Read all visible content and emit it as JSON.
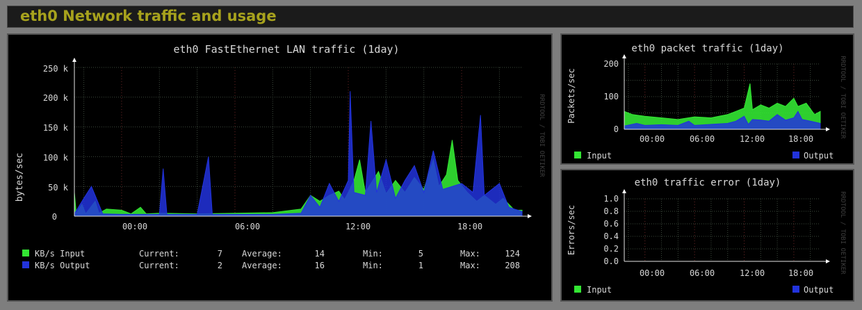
{
  "header": {
    "title": "eth0 Network traffic and usage"
  },
  "colors": {
    "input": "#33e633",
    "output": "#2233dd",
    "grid": "#3d4a3d",
    "accent": "#a7a21d"
  },
  "main_chart": {
    "title": "eth0 FastEthernet LAN traffic   (1day)",
    "ylabel": "bytes/sec",
    "watermark": "RRDTOOL / TOBI OETIKER",
    "y_ticks": [
      "250 k",
      "200 k",
      "150 k",
      "100 k",
      "50 k",
      "0"
    ],
    "x_ticks": [
      "00:00",
      "06:00",
      "12:00",
      "18:00"
    ],
    "legend": [
      {
        "name": "KB/s Input",
        "current_label": "Current:",
        "current": "7",
        "average_label": "Average:",
        "average": "14",
        "min_label": "Min:",
        "min": "5",
        "max_label": "Max:",
        "max": "124"
      },
      {
        "name": "KB/s Output",
        "current_label": "Current:",
        "current": "2",
        "average_label": "Average:",
        "average": "16",
        "min_label": "Min:",
        "min": "1",
        "max_label": "Max:",
        "max": "208"
      }
    ]
  },
  "packet_chart": {
    "title": "eth0 packet traffic   (1day)",
    "ylabel": "Packets/sec",
    "watermark": "RRDTOOL / TOBI OETIKER",
    "y_ticks": [
      "200",
      "100",
      "0"
    ],
    "x_ticks": [
      "00:00",
      "06:00",
      "12:00",
      "18:00"
    ],
    "legend_input": "Input",
    "legend_output": "Output"
  },
  "error_chart": {
    "title": "eth0 traffic error   (1day)",
    "ylabel": "Errors/sec",
    "watermark": "RRDTOOL / TOBI OETIKER",
    "y_ticks": [
      "1.0",
      "0.8",
      "0.6",
      "0.4",
      "0.2",
      "0.0"
    ],
    "x_ticks": [
      "00:00",
      "06:00",
      "12:00",
      "18:00"
    ],
    "legend_input": "Input",
    "legend_output": "Output"
  },
  "chart_data": [
    {
      "type": "area",
      "title": "eth0 FastEthernet LAN traffic   (1day)",
      "ylabel": "bytes/sec",
      "x_unit": "hours",
      "xlim": [
        -2.5,
        21.2
      ],
      "ylim": [
        0,
        250000
      ],
      "grid": true,
      "legend_placement": "bottom-left",
      "series": [
        {
          "name": "KB/s Input",
          "color": "#33e633",
          "points": [
            [
              -2.5,
              40000
            ],
            [
              -2.4,
              5000
            ],
            [
              -2.1,
              20000
            ],
            [
              -1.9,
              4000
            ],
            [
              -1.4,
              25000
            ],
            [
              -1.2,
              5000
            ],
            [
              -0.8,
              12000
            ],
            [
              0,
              10000
            ],
            [
              0.5,
              4000
            ],
            [
              1,
              15000
            ],
            [
              1.3,
              4000
            ],
            [
              2,
              5000
            ],
            [
              4,
              4000
            ],
            [
              6,
              5000
            ],
            [
              8,
              6000
            ],
            [
              9.5,
              12000
            ],
            [
              10,
              35000
            ],
            [
              10.5,
              25000
            ],
            [
              11,
              35000
            ],
            [
              11.5,
              42000
            ],
            [
              11.8,
              28000
            ],
            [
              12,
              40000
            ],
            [
              12.3,
              60000
            ],
            [
              12.6,
              95000
            ],
            [
              12.9,
              40000
            ],
            [
              13.2,
              55000
            ],
            [
              13.6,
              75000
            ],
            [
              14,
              38000
            ],
            [
              14.5,
              60000
            ],
            [
              15,
              40000
            ],
            [
              15.5,
              65000
            ],
            [
              16,
              45000
            ],
            [
              16.5,
              95000
            ],
            [
              16.8,
              50000
            ],
            [
              17.2,
              70000
            ],
            [
              17.5,
              128000
            ],
            [
              17.8,
              60000
            ],
            [
              18.3,
              40000
            ],
            [
              18.8,
              25000
            ],
            [
              19.2,
              35000
            ],
            [
              19.8,
              20000
            ],
            [
              20.2,
              30000
            ],
            [
              20.8,
              10000
            ],
            [
              21.2,
              10000
            ]
          ]
        },
        {
          "name": "KB/s Output",
          "color": "#2233dd",
          "points": [
            [
              -2.5,
              4000
            ],
            [
              -2,
              30000
            ],
            [
              -1.6,
              50000
            ],
            [
              -1,
              4000
            ],
            [
              0,
              3000
            ],
            [
              2,
              3000
            ],
            [
              2.2,
              80000
            ],
            [
              2.4,
              3000
            ],
            [
              4,
              3000
            ],
            [
              4.6,
              100000
            ],
            [
              4.8,
              3000
            ],
            [
              6,
              3000
            ],
            [
              8,
              3000
            ],
            [
              9.5,
              5000
            ],
            [
              10,
              35000
            ],
            [
              10.5,
              15000
            ],
            [
              11,
              55000
            ],
            [
              11.5,
              25000
            ],
            [
              12,
              60000
            ],
            [
              12.1,
              210000
            ],
            [
              12.3,
              40000
            ],
            [
              12.9,
              35000
            ],
            [
              13.2,
              160000
            ],
            [
              13.5,
              40000
            ],
            [
              14,
              95000
            ],
            [
              14.5,
              30000
            ],
            [
              15,
              60000
            ],
            [
              15.5,
              85000
            ],
            [
              16,
              40000
            ],
            [
              16.5,
              110000
            ],
            [
              17,
              45000
            ],
            [
              18,
              55000
            ],
            [
              18.6,
              40000
            ],
            [
              19,
              170000
            ],
            [
              19.2,
              35000
            ],
            [
              20,
              55000
            ],
            [
              20.5,
              15000
            ],
            [
              21.2,
              8000
            ]
          ]
        }
      ],
      "legend_stats": {
        "KB/s Input": {
          "current": 7,
          "average": 14,
          "min": 5,
          "max": 124
        },
        "KB/s Output": {
          "current": 2,
          "average": 16,
          "min": 1,
          "max": 208
        }
      }
    },
    {
      "type": "area",
      "title": "eth0 packet traffic   (1day)",
      "ylabel": "Packets/sec",
      "x_unit": "hours",
      "xlim": [
        -2.5,
        21.2
      ],
      "ylim": [
        0,
        200
      ],
      "grid": true,
      "series": [
        {
          "name": "Input",
          "color": "#33e633",
          "points": [
            [
              -2.5,
              55
            ],
            [
              -1.5,
              45
            ],
            [
              0,
              40
            ],
            [
              2,
              35
            ],
            [
              4,
              30
            ],
            [
              6,
              38
            ],
            [
              8,
              35
            ],
            [
              10,
              45
            ],
            [
              11,
              55
            ],
            [
              12,
              65
            ],
            [
              12.7,
              140
            ],
            [
              13,
              60
            ],
            [
              14,
              75
            ],
            [
              15,
              65
            ],
            [
              16,
              80
            ],
            [
              17,
              70
            ],
            [
              18,
              95
            ],
            [
              18.5,
              70
            ],
            [
              19.5,
              80
            ],
            [
              20.5,
              45
            ],
            [
              21.2,
              55
            ]
          ]
        },
        {
          "name": "Output",
          "color": "#2233dd",
          "points": [
            [
              -2.5,
              10
            ],
            [
              -1,
              18
            ],
            [
              0,
              12
            ],
            [
              2,
              14
            ],
            [
              4,
              12
            ],
            [
              5.3,
              25
            ],
            [
              6,
              12
            ],
            [
              8,
              15
            ],
            [
              10,
              18
            ],
            [
              11,
              25
            ],
            [
              12,
              40
            ],
            [
              12.5,
              15
            ],
            [
              13,
              30
            ],
            [
              14,
              28
            ],
            [
              15,
              25
            ],
            [
              16,
              45
            ],
            [
              17,
              28
            ],
            [
              18,
              35
            ],
            [
              18.5,
              55
            ],
            [
              19,
              30
            ],
            [
              20,
              25
            ],
            [
              21.2,
              18
            ]
          ]
        }
      ]
    },
    {
      "type": "line",
      "title": "eth0 traffic error   (1day)",
      "ylabel": "Errors/sec",
      "x_unit": "hours",
      "xlim": [
        -2.5,
        21.2
      ],
      "ylim": [
        0,
        1.0
      ],
      "grid": true,
      "series": [
        {
          "name": "Input",
          "color": "#33e633",
          "points": [
            [
              -2.5,
              0
            ],
            [
              21.2,
              0
            ]
          ]
        },
        {
          "name": "Output",
          "color": "#2233dd",
          "points": [
            [
              -2.5,
              0
            ],
            [
              21.2,
              0
            ]
          ]
        }
      ]
    }
  ]
}
